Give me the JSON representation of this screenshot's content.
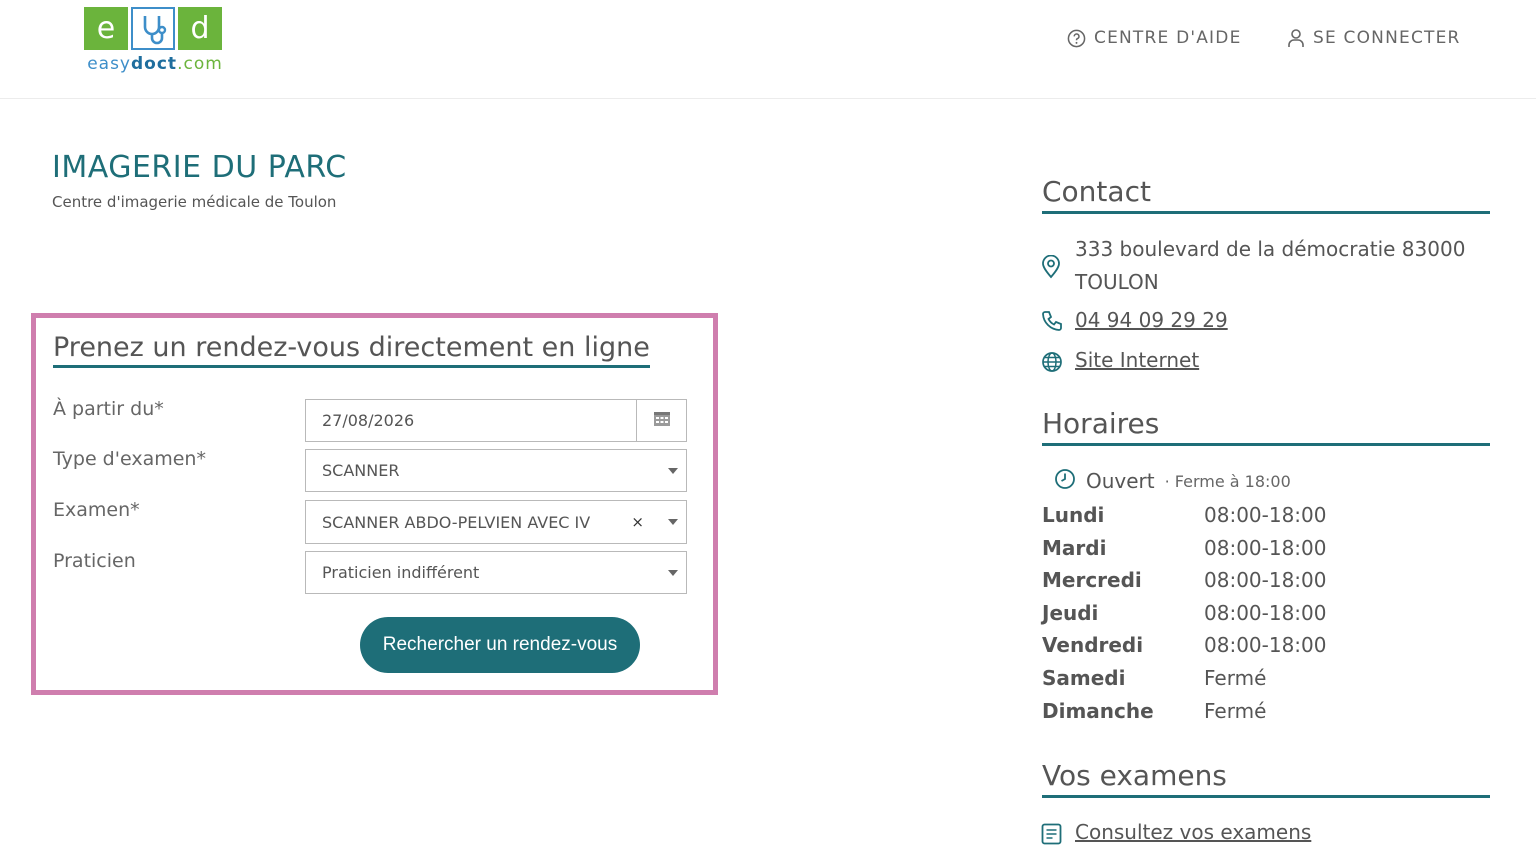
{
  "header": {
    "logo": {
      "letters": [
        "e",
        "d"
      ],
      "brand_light": "easy",
      "brand_bold": "doct",
      "brand_suffix": ".com"
    },
    "nav": {
      "help": "CENTRE D'AIDE",
      "login": "SE CONNECTER"
    }
  },
  "page": {
    "title": "IMAGERIE DU PARC",
    "subtitle": "Centre d'imagerie médicale de Toulon"
  },
  "booking": {
    "title": "Prenez un rendez-vous directement en ligne",
    "fields": {
      "date": {
        "label": "À partir du*",
        "value": "27/08/2026"
      },
      "exam_type": {
        "label": "Type d'examen*",
        "value": "SCANNER"
      },
      "exam": {
        "label": "Examen*",
        "value": "SCANNER ABDO-PELVIEN AVEC IV",
        "clear": "×"
      },
      "practitioner": {
        "label": "Praticien",
        "value": "Praticien indifférent"
      }
    },
    "search_label": "Rechercher un rendez-vous"
  },
  "contact": {
    "title": "Contact",
    "address_line1": "333 boulevard de la démocratie 83000",
    "address_line2": "TOULON",
    "phone": "04 94 09 29 29",
    "website": "Site Internet"
  },
  "hours": {
    "title": "Horaires",
    "status": "Ouvert",
    "closing": "· Ferme à 18:00",
    "days": [
      {
        "day": "Lundi",
        "hours": "08:00-18:00"
      },
      {
        "day": "Mardi",
        "hours": "08:00-18:00"
      },
      {
        "day": "Mercredi",
        "hours": "08:00-18:00"
      },
      {
        "day": "Jeudi",
        "hours": "08:00-18:00"
      },
      {
        "day": "Vendredi",
        "hours": "08:00-18:00"
      },
      {
        "day": "Samedi",
        "hours": "Fermé"
      },
      {
        "day": "Dimanche",
        "hours": "Fermé"
      }
    ]
  },
  "exams": {
    "title": "Vos examens",
    "link": "Consultez vos examens"
  },
  "colors": {
    "brand_teal": "#1e6e78",
    "highlight_pink": "#cf7eae",
    "logo_green": "#6bb43c",
    "logo_blue": "#3d8ec9"
  }
}
